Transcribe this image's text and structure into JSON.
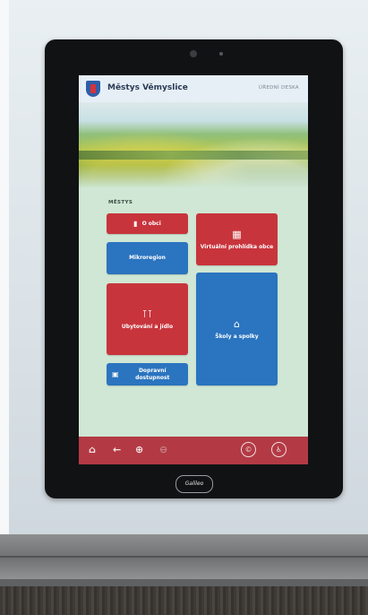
{
  "header": {
    "title": "Městys Věmyslice",
    "right_label": "ÚŘEDNÍ DESKA"
  },
  "section_label": "MĚSTYS",
  "tiles": {
    "about": {
      "label": "O obci",
      "icon": "info-icon"
    },
    "virtual_tour": {
      "label": "Virtuální prohlídka obce",
      "icon": "map-icon"
    },
    "microregion": {
      "label": "Mikroregion"
    },
    "accommodation": {
      "label": "Ubytování a jídlo",
      "icon": "cutlery-icon"
    },
    "schools": {
      "label": "Školy a spolky",
      "icon": "home-icon"
    },
    "transport": {
      "label": "Dopravní dostupnost",
      "icon": "car-icon"
    }
  },
  "toolbar": {
    "home": "⌂",
    "back": "←",
    "zoom_in": "⊕",
    "zoom_out": "⊖",
    "left_circle": "©",
    "right_circle": "♿"
  },
  "device": {
    "brand": "Galileo"
  },
  "colors": {
    "tile_red": "#c8343c",
    "tile_blue": "#2b74bf",
    "toolbar": "#b33a44",
    "screen_bg": "#cfe7d4"
  }
}
